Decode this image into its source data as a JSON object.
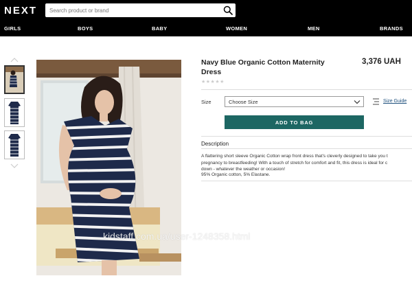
{
  "header": {
    "logo": "NEXT",
    "search_placeholder": "Search product or brand",
    "nav": [
      "GIRLS",
      "BOYS",
      "BABY",
      "WOMEN",
      "MEN",
      "BRANDS"
    ]
  },
  "product": {
    "title": "Navy Blue Organic Cotton Maternity Dress",
    "price": "3,376 UAH",
    "rating_stars": "★★★★★",
    "size_label": "Size",
    "size_selected": "Choose Size",
    "size_guide": "Size Guide",
    "add_to_bag": "ADD TO BAG",
    "description_title": "Description",
    "description_lines": [
      "A flattering short sleeve Organic Cotton wrap front dress that's cleverly designed to take you t",
      "pregnancy to breastfeeding! With a touch of stretch for comfort and fit, this dress is ideal for c",
      "down - whatever the weather or occasion!"
    ],
    "composition": "95% Organic cotton, 5% Elastane."
  },
  "watermark": "kidstaff.com.ua/user-1248358.html",
  "colors": {
    "header_bg": "#000000",
    "accent_button": "#1d6763",
    "link": "#1d4f7c",
    "dress_navy": "#1e2a4a"
  }
}
